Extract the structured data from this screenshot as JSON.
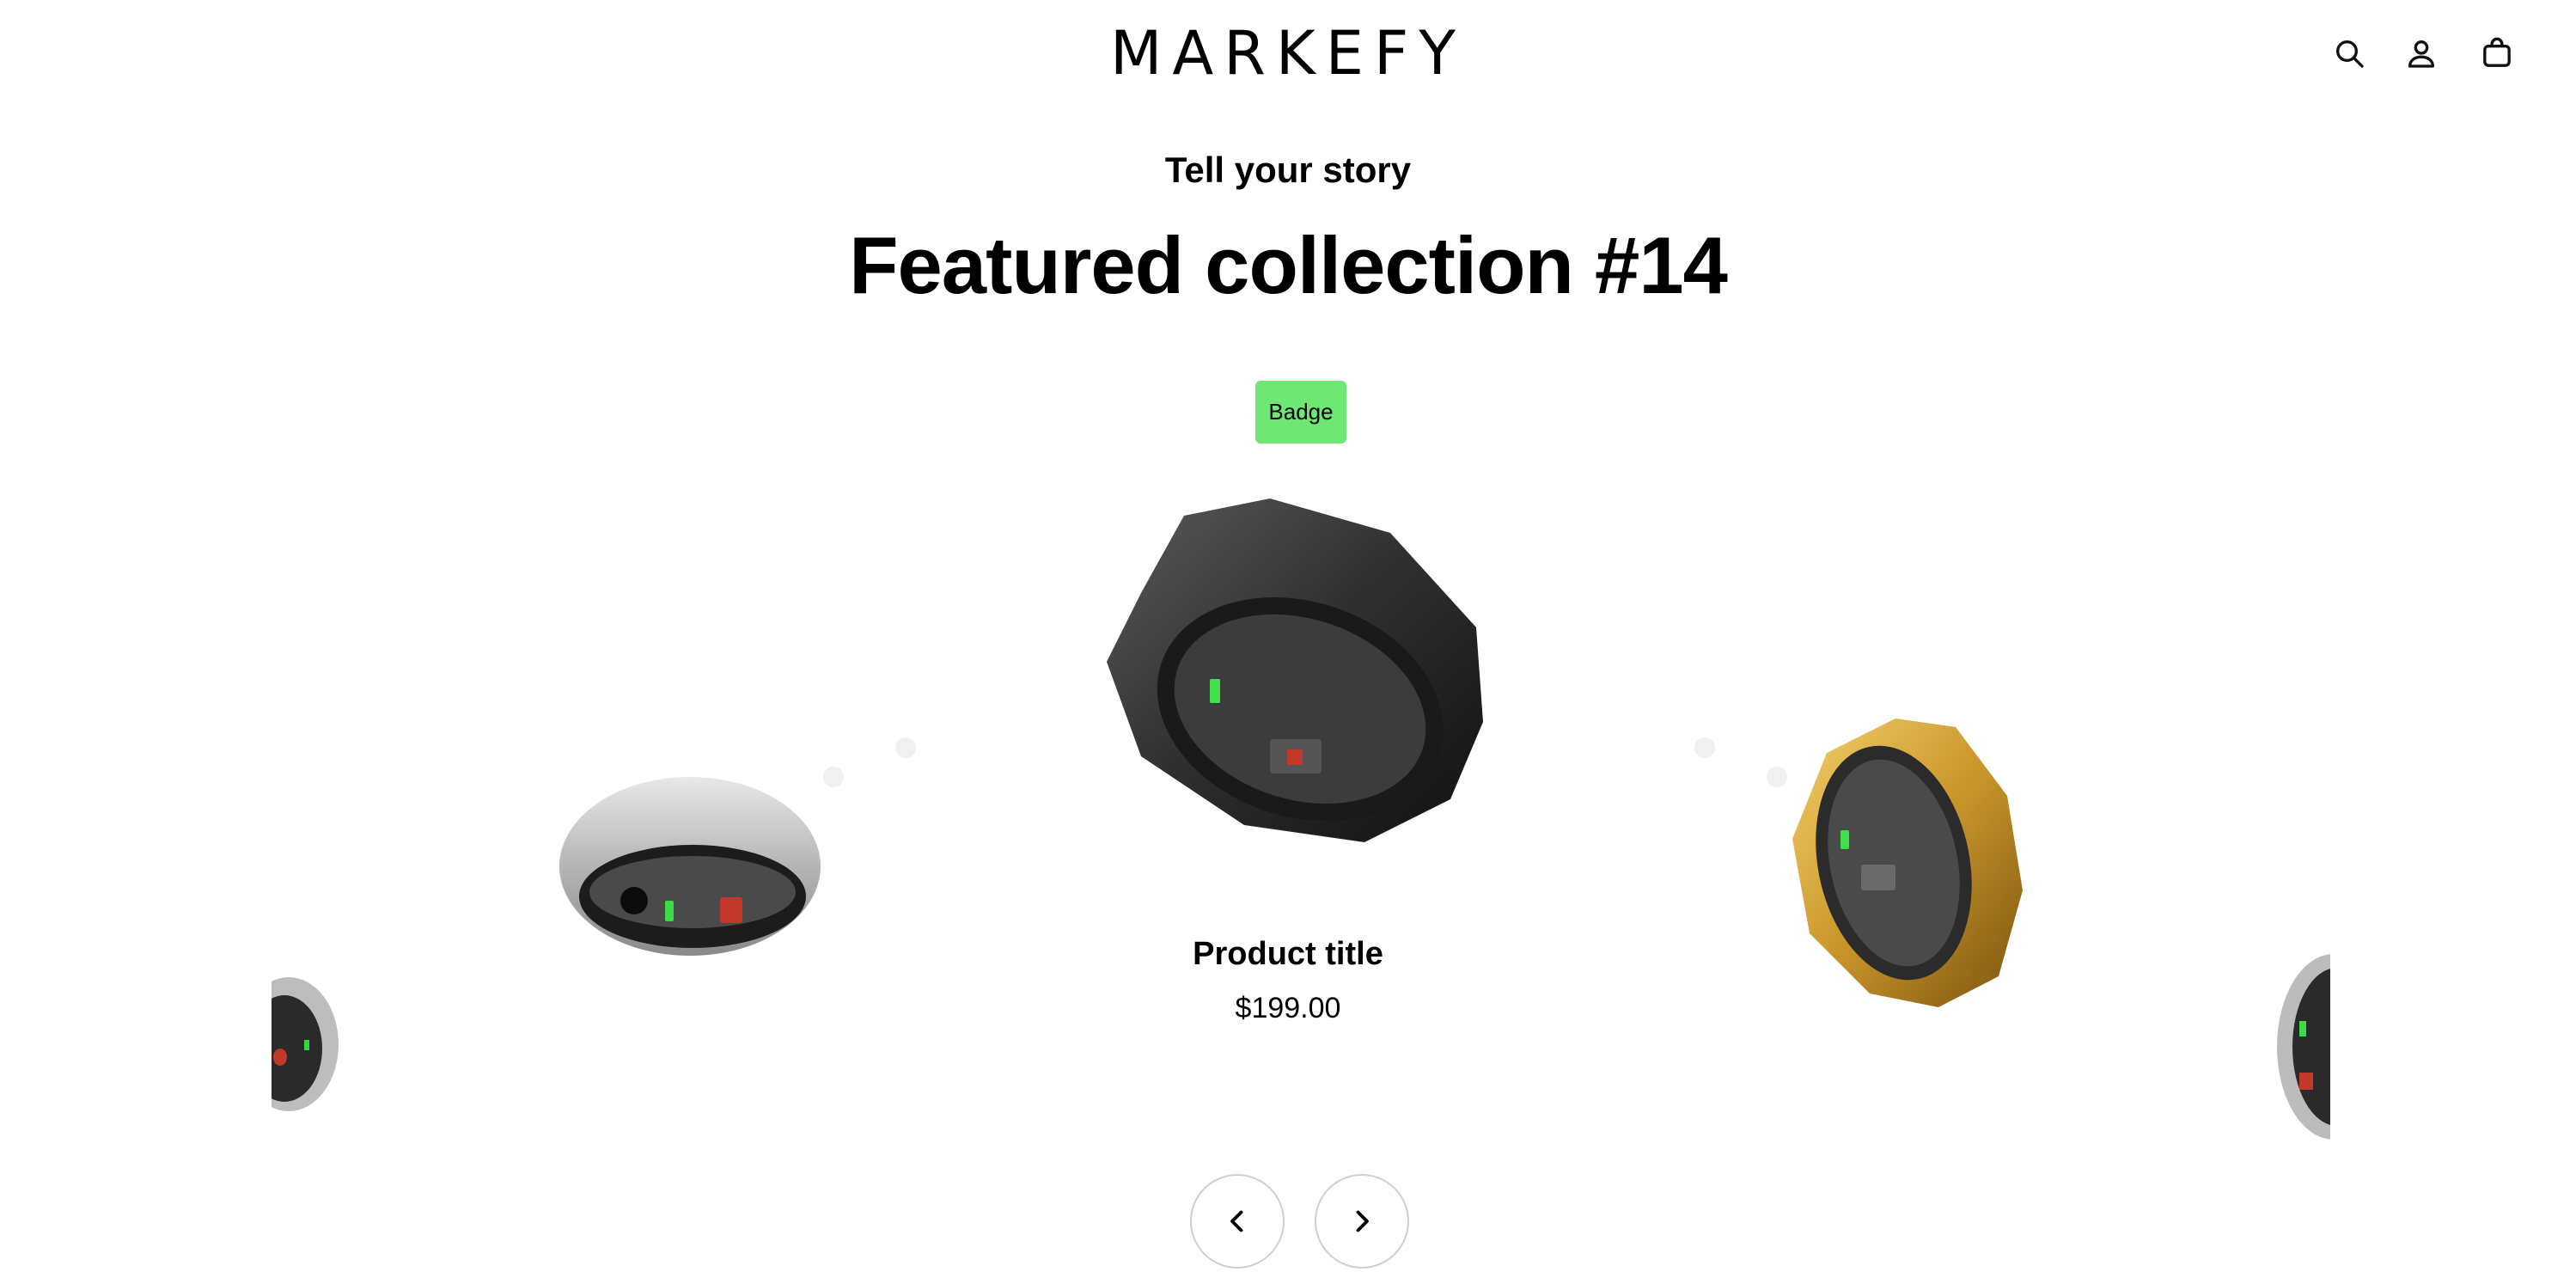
{
  "header": {
    "logo": "MARKEFY",
    "icons": [
      "search-icon",
      "account-icon",
      "cart-icon"
    ]
  },
  "section": {
    "subheading": "Tell your story",
    "title": "Featured collection #14",
    "badge": "Badge"
  },
  "product": {
    "title": "Product title",
    "price": "$199.00"
  },
  "carousel": {
    "prev_icon": "chevron-left-icon",
    "next_icon": "chevron-right-icon"
  },
  "colors": {
    "badge_bg": "#6ee775",
    "text": "#000000",
    "background": "#ffffff"
  }
}
